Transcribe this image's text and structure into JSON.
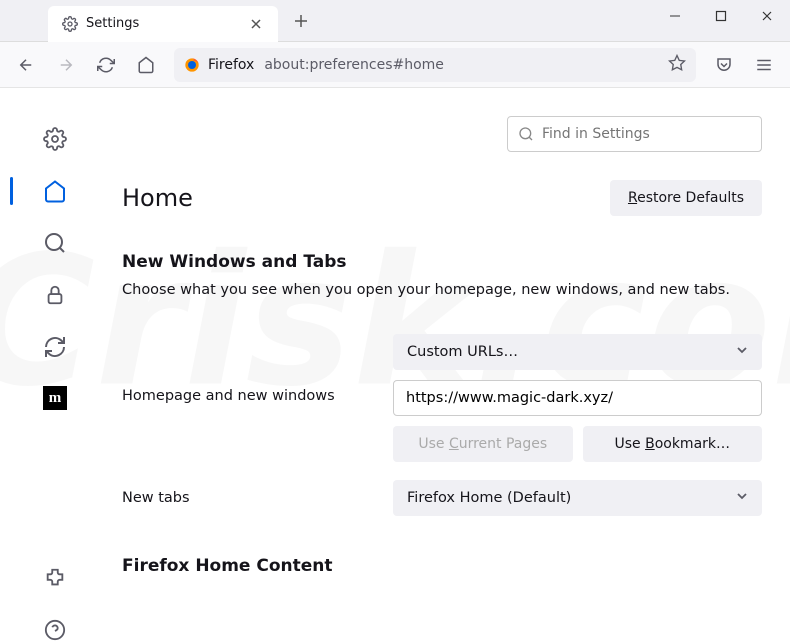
{
  "tab": {
    "title": "Settings"
  },
  "urlbar": {
    "context": "Firefox",
    "url": "about:preferences#home"
  },
  "search": {
    "placeholder": "Find in Settings"
  },
  "page": {
    "title": "Home"
  },
  "restore_btn": "Restore Defaults",
  "section1": {
    "title": "New Windows and Tabs",
    "desc": "Choose what you see when you open your homepage, new windows, and new tabs."
  },
  "homepage": {
    "label": "Homepage and new windows",
    "select": "Custom URLs…",
    "url_value": "https://www.magic-dark.xyz/",
    "use_current": "Use Current Pages",
    "use_bookmark": "Use Bookmark…"
  },
  "newtabs": {
    "label": "New tabs",
    "select": "Firefox Home (Default)"
  },
  "section2": {
    "title": "Firefox Home Content"
  }
}
